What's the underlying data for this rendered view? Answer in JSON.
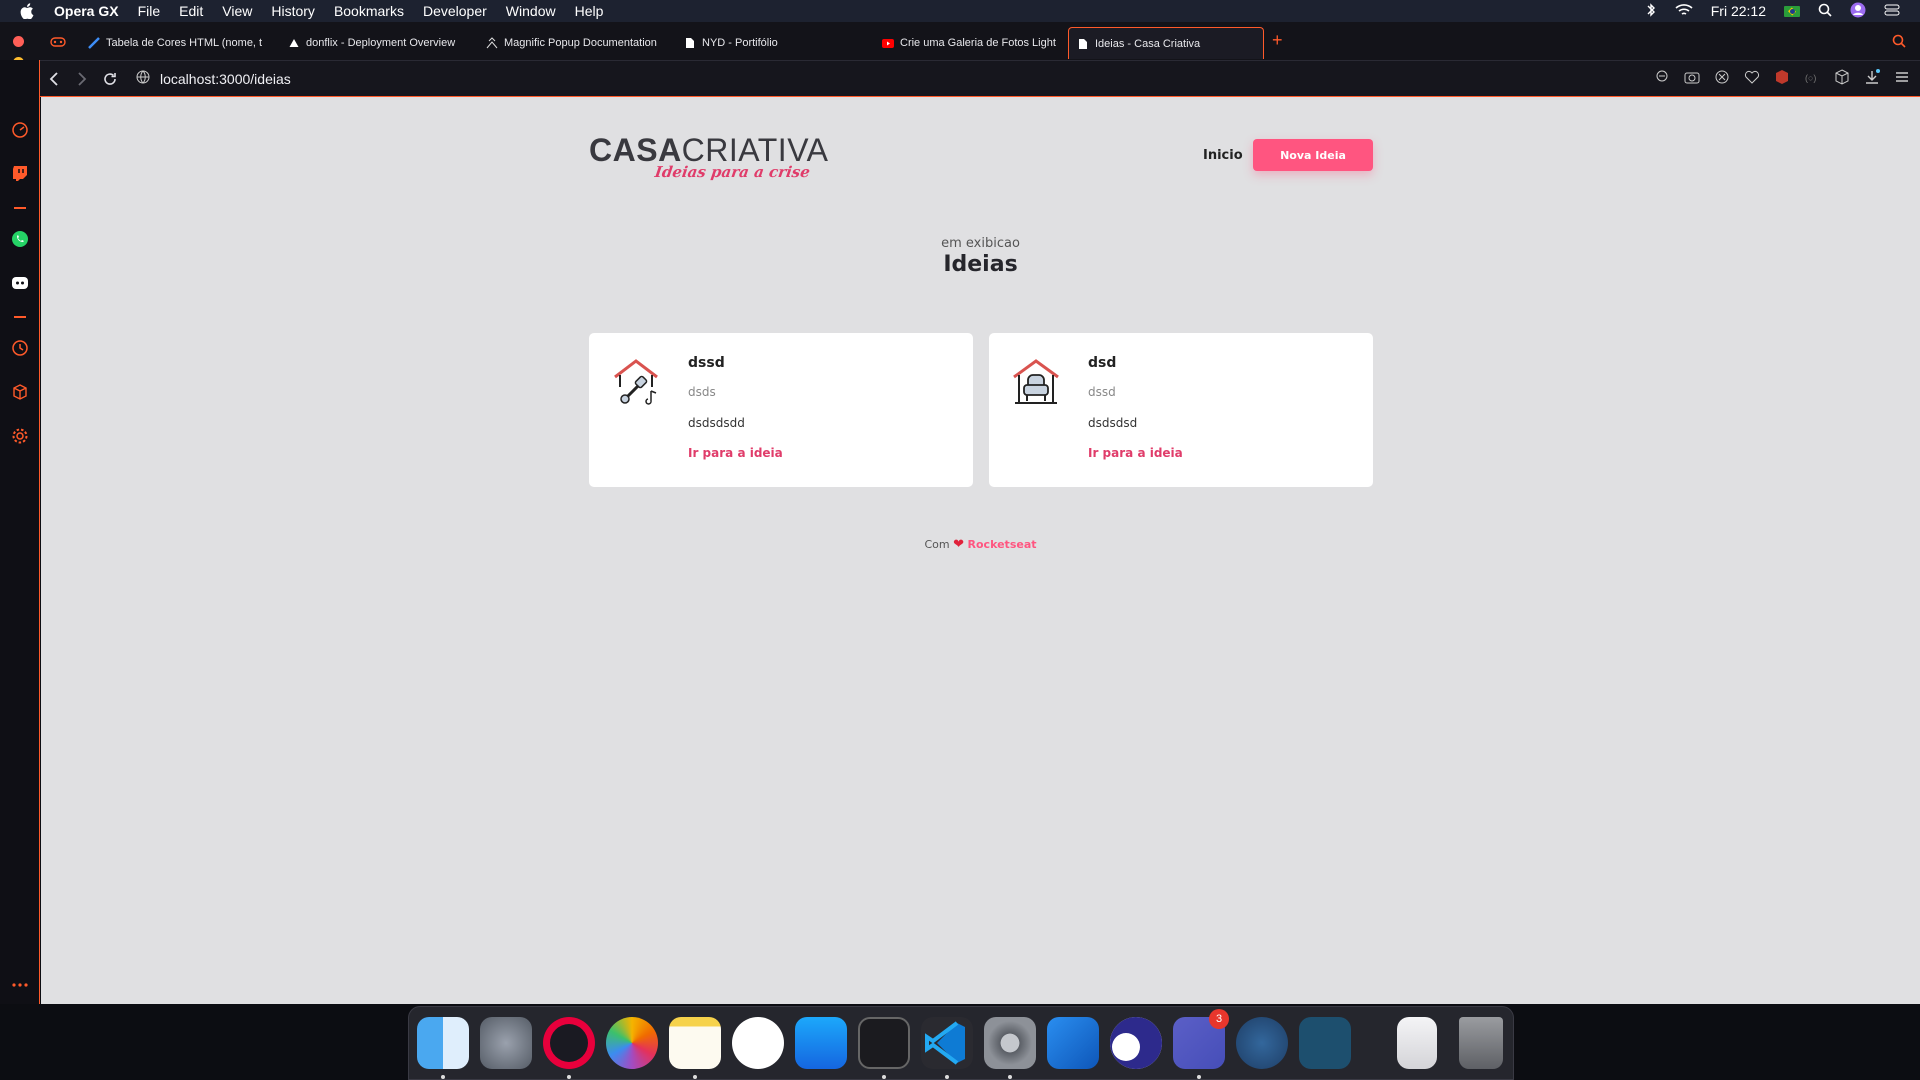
{
  "menubar": {
    "app": "Opera GX",
    "items": [
      "File",
      "Edit",
      "View",
      "History",
      "Bookmarks",
      "Developer",
      "Window",
      "Help"
    ],
    "clock": "Fri 22:12"
  },
  "tabs": [
    {
      "label": "Tabela de Cores HTML (nome, t",
      "icon": "color-table-icon"
    },
    {
      "label": "donflix - Deployment Overview",
      "icon": "vercel-triangle-icon"
    },
    {
      "label": "Magnific Popup Documentation",
      "icon": "magnific-icon"
    },
    {
      "label": "NYD - Portifólio",
      "icon": "document-icon"
    },
    {
      "label": "Crie uma Galeria de Fotos Light",
      "icon": "youtube-icon"
    },
    {
      "label": "Ideias - Casa Criativa",
      "icon": "document-icon",
      "active": true
    }
  ],
  "address": {
    "url": "localhost:3000/ideias"
  },
  "site": {
    "logo_main_bold": "CASA",
    "logo_main_light": "CRIATIVA",
    "logo_tagline": "Ideias para a crise",
    "nav_inicio": "Inicio",
    "nav_button": "Nova Ideia",
    "section_subtitle": "em exibicao",
    "section_title": "Ideias",
    "cards": [
      {
        "title": "dssd",
        "category": "dsds",
        "description": "dsdsdsdd",
        "link": "Ir para a ideia",
        "icon": "house-guitar-icon"
      },
      {
        "title": "dsd",
        "category": "dssd",
        "description": "dsdsdsd",
        "link": "Ir para a ideia",
        "icon": "house-chair-icon"
      }
    ],
    "footer_prefix": "Com",
    "footer_brand": "Rocketseat"
  },
  "dock": {
    "apps": [
      "finder",
      "launchpad",
      "opera-gx",
      "photos",
      "notes",
      "music",
      "app-store",
      "terminal",
      "vscode",
      "system-preferences",
      "xcode",
      "beekeeper",
      "teams",
      "postgres",
      "mysql-workbench",
      "archive",
      "trash"
    ],
    "teams_badge": "3"
  },
  "colors": {
    "accent": "#ff5580",
    "opera_accent": "#ff5a2a",
    "page_bg": "#e0e0e2"
  }
}
